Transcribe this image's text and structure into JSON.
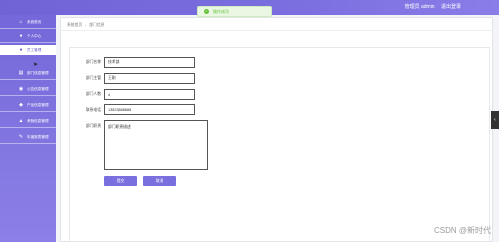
{
  "header": {
    "user_text": "管理员 admin",
    "logout_label": "退出登录",
    "toast": {
      "icon": "check-circle-icon",
      "text": "操作成功"
    }
  },
  "sidebar": {
    "items": [
      {
        "label": "系统首页",
        "icon": "home-icon",
        "active": false
      },
      {
        "label": "个人中心",
        "icon": "user-icon",
        "active": false
      },
      {
        "label": "员工管理",
        "icon": "users-icon",
        "active": true
      },
      {
        "label": "部门信息管理",
        "icon": "department-icon",
        "active": false
      },
      {
        "label": "公告信息管理",
        "icon": "notice-icon",
        "active": false
      },
      {
        "label": "产品信息管理",
        "icon": "product-icon",
        "active": false
      },
      {
        "label": "考勤信息管理",
        "icon": "attendance-icon",
        "active": false
      },
      {
        "label": "年度报表管理",
        "icon": "report-icon",
        "active": false
      }
    ]
  },
  "breadcrumb": {
    "home": "系统首页",
    "separator": "/",
    "current": "部门信息"
  },
  "form": {
    "fields": [
      {
        "label": "部门名称",
        "value": "技术部"
      },
      {
        "label": "部门主管",
        "value": "王刚"
      },
      {
        "label": "部门人数",
        "value": "4"
      },
      {
        "label": "联系电话",
        "value": "13823888888"
      }
    ],
    "description": {
      "label": "部门职责",
      "value": "部门职责描述"
    },
    "submit_label": "提交",
    "cancel_label": "取消"
  },
  "right_tab": {
    "icon": "chevron-left-icon"
  },
  "watermark": "CSDN @新时代"
}
